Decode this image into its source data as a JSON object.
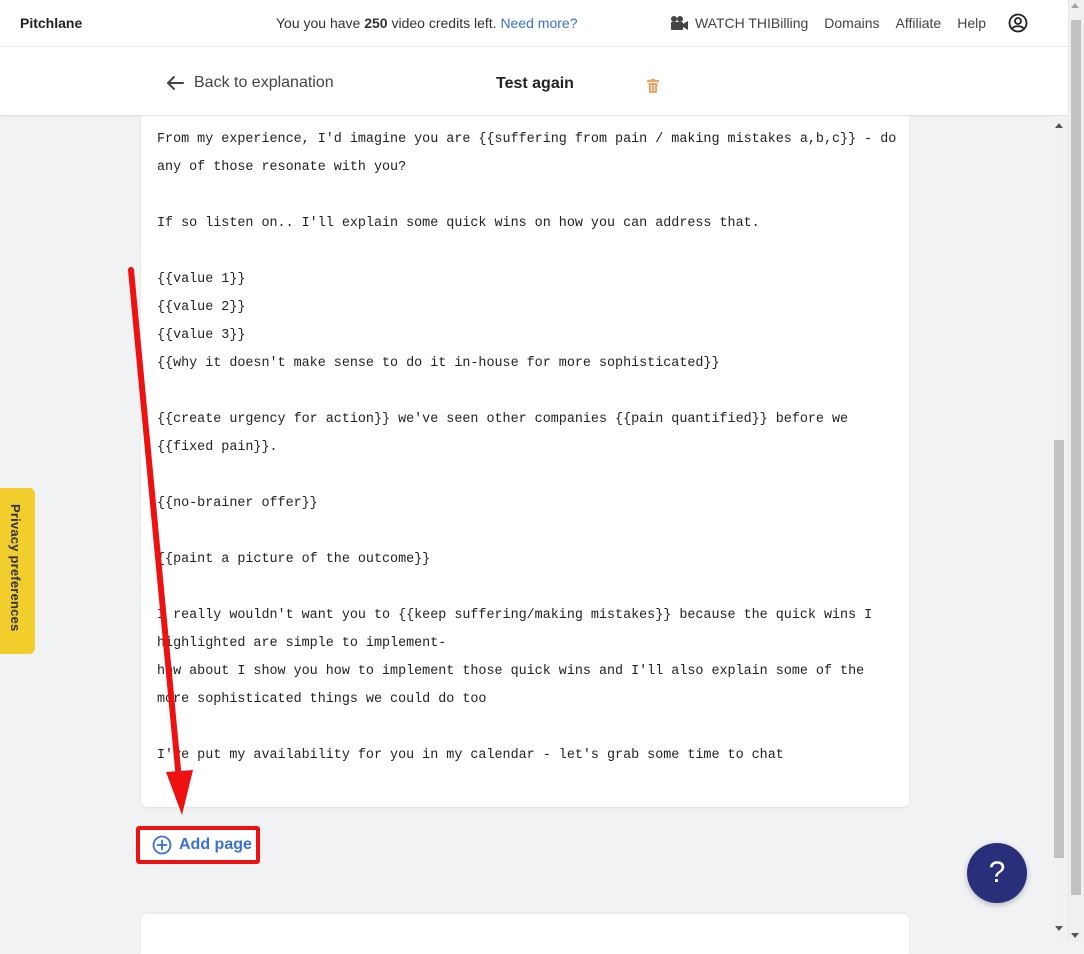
{
  "topbar": {
    "brand": "Pitchlane",
    "credits_prefix": "You you have",
    "credits_count": "250",
    "credits_suffix": "video credits left.",
    "credits_link": "Need more?",
    "nav": {
      "watch": "WATCH THI",
      "billing": "Billing",
      "domains": "Domains",
      "affiliate": "Affiliate",
      "help": "Help"
    }
  },
  "subheader": {
    "back_label": "Back to explanation",
    "title": "Test again"
  },
  "script_lines": [
    "From my experience, I'd imagine you are {{suffering from pain / making mistakes a,b,c}} - do any of those resonate with you?",
    "",
    "If so listen on.. I'll explain some quick wins on how you can address that.",
    "",
    "{{value 1}}",
    "{{value 2}}",
    "{{value 3}}",
    "{{why it doesn't make sense to do it in-house for more sophisticated}}",
    "",
    "{{create urgency for action}} we've seen other companies {{pain quantified}} before we {{fixed pain}}.",
    "",
    "{{no-brainer offer}}",
    "",
    "{{paint a picture of the outcome}}",
    "",
    "I really wouldn't want you to {{keep suffering/making mistakes}} because the quick wins I highlighted are simple to implement-",
    "how about I show you how to implement those quick wins and I'll also explain some of the more sophisticated things we could do too",
    "",
    "I've put my availability for you in my calendar - let's grab some time to chat"
  ],
  "add_page_label": "Add page",
  "privacy_label": "Privacy preferences",
  "help_bubble": "?",
  "colors": {
    "accent": "#3a6fd8",
    "annotation": "#ee1111",
    "privacy_tab": "#f2ce2c",
    "help_bubble": "#2a2f7c",
    "trash": "#f0a35e"
  }
}
